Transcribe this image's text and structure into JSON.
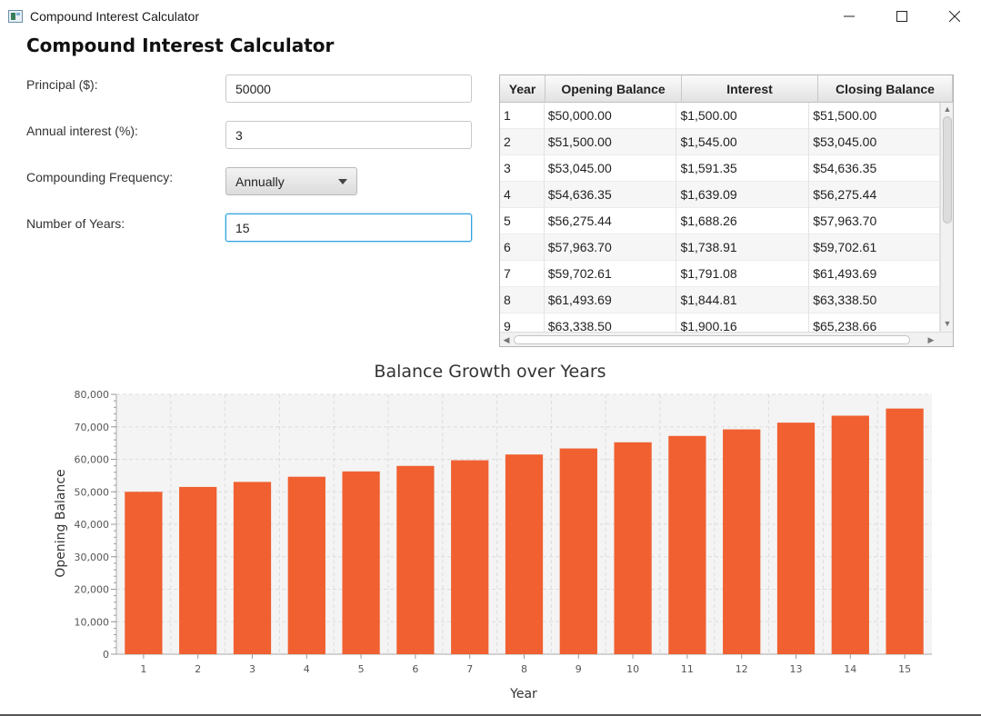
{
  "window": {
    "title": "Compound Interest Calculator"
  },
  "heading": "Compound Interest Calculator",
  "form": {
    "principal_label": "Principal ($):",
    "principal_value": "50000",
    "interest_label": "Annual interest (%):",
    "interest_value": "3",
    "frequency_label": "Compounding Frequency:",
    "frequency_value": "Annually",
    "years_label": "Number of Years:",
    "years_value": "15"
  },
  "table": {
    "headers": [
      "Year",
      "Opening Balance",
      "Interest",
      "Closing Balance"
    ],
    "rows": [
      [
        "1",
        "$50,000.00",
        "$1,500.00",
        "$51,500.00"
      ],
      [
        "2",
        "$51,500.00",
        "$1,545.00",
        "$53,045.00"
      ],
      [
        "3",
        "$53,045.00",
        "$1,591.35",
        "$54,636.35"
      ],
      [
        "4",
        "$54,636.35",
        "$1,639.09",
        "$56,275.44"
      ],
      [
        "5",
        "$56,275.44",
        "$1,688.26",
        "$57,963.70"
      ],
      [
        "6",
        "$57,963.70",
        "$1,738.91",
        "$59,702.61"
      ],
      [
        "7",
        "$59,702.61",
        "$1,791.08",
        "$61,493.69"
      ],
      [
        "8",
        "$61,493.69",
        "$1,844.81",
        "$63,338.50"
      ],
      [
        "9",
        "$63,338.50",
        "$1,900.16",
        "$65,238.66"
      ]
    ]
  },
  "chart_data": {
    "type": "bar",
    "title": "Balance Growth over Years",
    "xlabel": "Year",
    "ylabel": "Opening Balance",
    "categories": [
      "1",
      "2",
      "3",
      "4",
      "5",
      "6",
      "7",
      "8",
      "9",
      "10",
      "11",
      "12",
      "13",
      "14",
      "15"
    ],
    "values": [
      50000,
      51500,
      53045,
      54636.35,
      56275.44,
      57963.7,
      59702.61,
      61493.69,
      63338.5,
      65238.66,
      67195.82,
      69211.69,
      71288.04,
      73426.68,
      75629.48
    ],
    "ylim": [
      0,
      80000
    ],
    "yticks": [
      "0",
      "10,000",
      "20,000",
      "30,000",
      "40,000",
      "50,000",
      "60,000",
      "70,000",
      "80,000"
    ],
    "grid": true,
    "bar_color": "#f06030",
    "plot_background": "#f4f4f4",
    "grid_color": "#dddddd"
  }
}
